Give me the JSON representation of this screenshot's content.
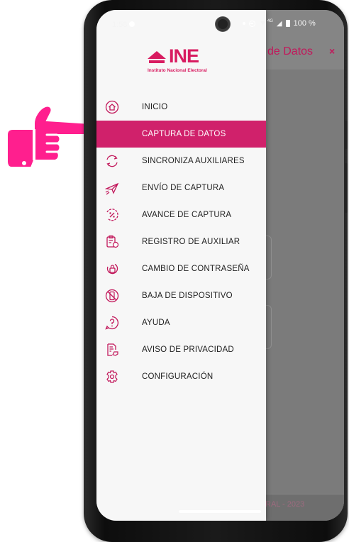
{
  "status_bar": {
    "time": "1:58",
    "network": "4G",
    "battery": "100 %"
  },
  "app": {
    "title": "de Datos",
    "close": "×",
    "footer": "RAL - 2023"
  },
  "logo": {
    "word": "INE",
    "subtitle": "Instituto Nacional Electoral"
  },
  "menu": [
    {
      "label": "INICIO",
      "icon": "home-icon"
    },
    {
      "label": "CAPTURA DE DATOS",
      "icon": "",
      "active": true
    },
    {
      "label": "SINCRONIZA AUXILIARES",
      "icon": "sync-icon"
    },
    {
      "label": "ENVÍO DE CAPTURA",
      "icon": "send-icon"
    },
    {
      "label": "AVANCE DE CAPTURA",
      "icon": "percent-icon"
    },
    {
      "label": "REGISTRO DE AUXILIAR",
      "icon": "clipboard-user-icon"
    },
    {
      "label": "CAMBIO DE CONTRASEÑA",
      "icon": "lock-refresh-icon"
    },
    {
      "label": "BAJA DE DISPOSITIVO",
      "icon": "phone-off-icon"
    },
    {
      "label": "AYUDA",
      "icon": "help-icon"
    },
    {
      "label": "AVISO DE PRIVACIDAD",
      "icon": "document-hand-icon"
    },
    {
      "label": "CONFIGURACIÓN",
      "icon": "settings-icon"
    }
  ],
  "colors": {
    "accent": "#d0216b",
    "drawer_bg": "#f7f7f7"
  }
}
